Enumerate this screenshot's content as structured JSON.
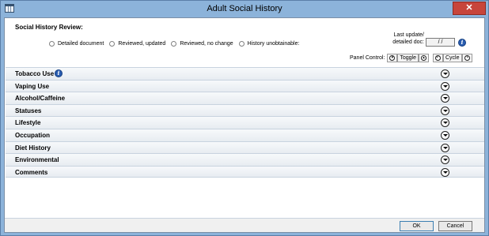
{
  "window": {
    "title": "Adult Social History",
    "close_label": "✕"
  },
  "review": {
    "header": "Social History Review:",
    "options": [
      "Detailed document",
      "Reviewed, updated",
      "Reviewed, no change",
      "History unobtainable:"
    ]
  },
  "last_update": {
    "label_line1": "Last update/",
    "label_line2": "detailed doc:",
    "value": "/ /"
  },
  "panel_control": {
    "label": "Panel Control:",
    "toggle": "Toggle",
    "cycle": "Cycle"
  },
  "sections": [
    {
      "label": "Tobacco Use",
      "has_info": true
    },
    {
      "label": "Vaping Use",
      "has_info": false
    },
    {
      "label": "Alcohol/Caffeine",
      "has_info": false
    },
    {
      "label": "Statuses",
      "has_info": false
    },
    {
      "label": "Lifestyle",
      "has_info": false
    },
    {
      "label": "Occupation",
      "has_info": false
    },
    {
      "label": "Diet History",
      "has_info": false
    },
    {
      "label": "Environmental",
      "has_info": false
    },
    {
      "label": "Comments",
      "has_info": false
    }
  ],
  "footer": {
    "ok": "OK",
    "cancel": "Cancel"
  },
  "icons": {
    "info": "info-icon",
    "expand": "chevron-down-icon"
  },
  "colors": {
    "title_bar": "#8cb3da",
    "close_button": "#c7453b",
    "info_icon": "#2a5db0"
  }
}
